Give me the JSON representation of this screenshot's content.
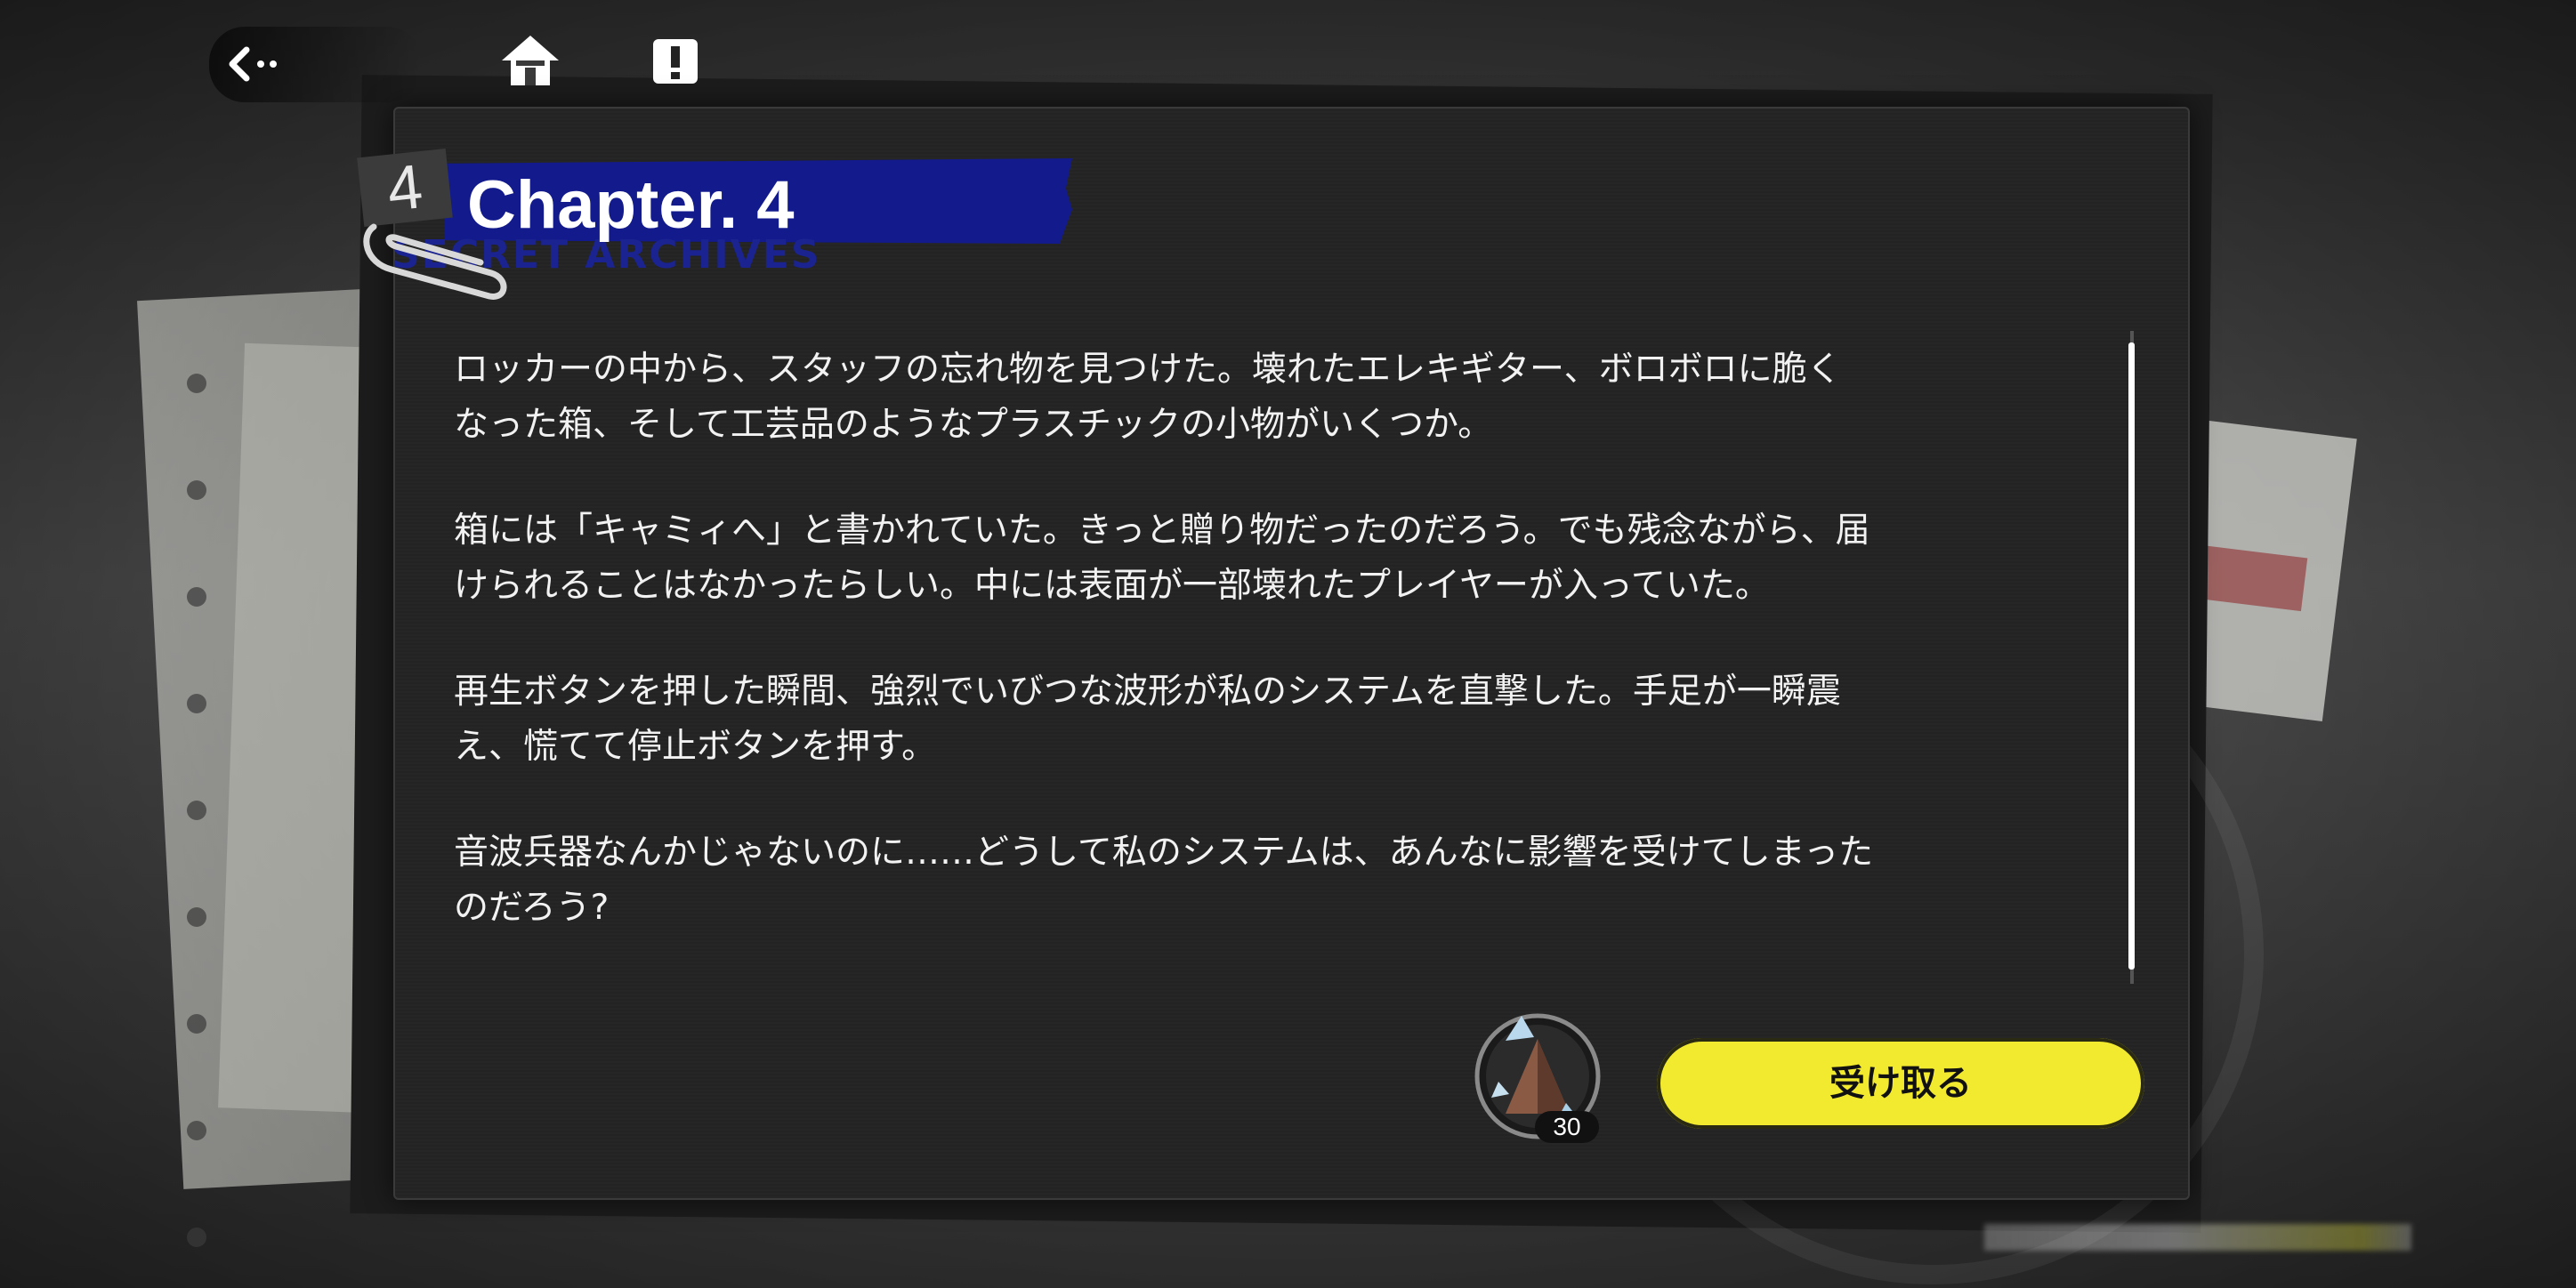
{
  "topbar": {
    "back_icon": "back-arrow-icon",
    "home_icon": "home-icon",
    "alert_icon": "exclamation-icon"
  },
  "chapter": {
    "number": "4",
    "title": "Chapter. 4",
    "subtitle": "SECRET ARCHIVES"
  },
  "story": {
    "paragraphs": [
      "ロッカーの中から、スタッフの忘れ物を見つけた。壊れたエレキギター、ボロボロに脆く\nなった箱、そして工芸品のようなプラスチックの小物がいくつか。",
      "箱には「キャミィへ」と書かれていた。きっと贈り物だったのだろう。でも残念ながら、届\nけられることはなかったらしい。中には表面が一部壊れたプレイヤーが入っていた。",
      "再生ボタンを押した瞬間、強烈でいびつな波形が私のシステムを直撃した。手足が一瞬震\nえ、慌てて停止ボタンを押す。",
      "音波兵器なんかじゃないのに……どうして私のシステムは、あんなに影響を受けてしまった\nのだろう?"
    ]
  },
  "reward": {
    "icon": "pyramid-crystal-icon",
    "quantity": "30"
  },
  "claim_button": {
    "label": "受け取る"
  },
  "colors": {
    "accent_yellow": "#f2ea2f",
    "chapter_band_blue": "#121a8c",
    "panel_bg": "#232323"
  }
}
